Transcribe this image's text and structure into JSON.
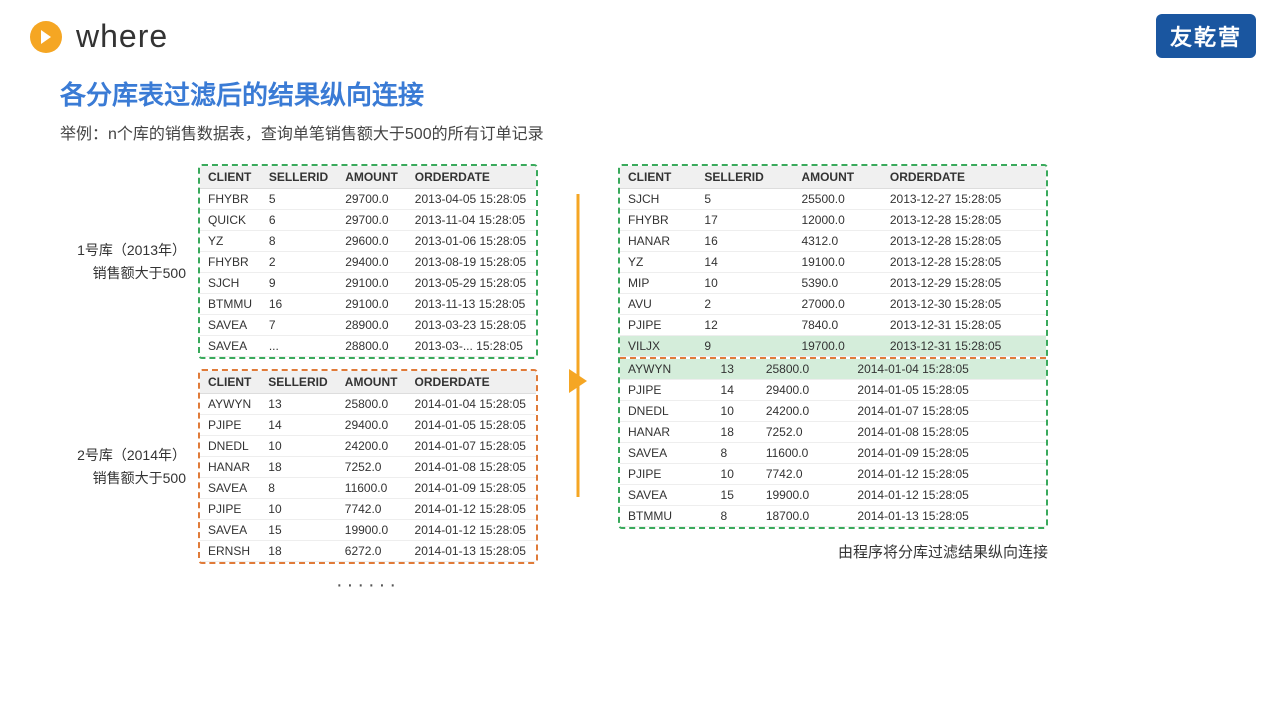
{
  "header": {
    "title": "where",
    "icon": "chevron-right",
    "logo": "友乾营"
  },
  "section": {
    "title": "各分库表过滤后的结果纵向连接",
    "subtitle": "举例：n个库的销售数据表，查询单笔销售额大于500的所有订单记录"
  },
  "db1": {
    "label_line1": "1号库（2013年）",
    "label_line2": "销售额大于500",
    "columns": [
      "CLIENT",
      "SELLERID",
      "AMOUNT",
      "ORDERDATE"
    ],
    "rows": [
      [
        "FHYBR",
        "5",
        "29700.0",
        "2013-04-05 15:28:05"
      ],
      [
        "QUICK",
        "6",
        "29700.0",
        "2013-11-04 15:28:05"
      ],
      [
        "YZ",
        "8",
        "29600.0",
        "2013-01-06 15:28:05"
      ],
      [
        "FHYBR",
        "2",
        "29400.0",
        "2013-08-19 15:28:05"
      ],
      [
        "SJCH",
        "9",
        "29100.0",
        "2013-05-29 15:28:05"
      ],
      [
        "BTMMU",
        "16",
        "29100.0",
        "2013-11-13 15:28:05"
      ],
      [
        "SAVEA",
        "7",
        "28900.0",
        "2013-03-23 15:28:05"
      ],
      [
        "SAVEA",
        "...",
        "28800.0",
        "2013-03-... 15:28:05"
      ]
    ]
  },
  "db2": {
    "label_line1": "2号库（2014年）",
    "label_line2": "销售额大于500",
    "columns": [
      "CLIENT",
      "SELLERID",
      "AMOUNT",
      "ORDERDATE"
    ],
    "rows": [
      [
        "AYWYN",
        "13",
        "25800.0",
        "2014-01-04 15:28:05"
      ],
      [
        "PJIPE",
        "14",
        "29400.0",
        "2014-01-05 15:28:05"
      ],
      [
        "DNEDL",
        "10",
        "24200.0",
        "2014-01-07 15:28:05"
      ],
      [
        "HANAR",
        "18",
        "7252.0",
        "2014-01-08 15:28:05"
      ],
      [
        "SAVEA",
        "8",
        "11600.0",
        "2014-01-09 15:28:05"
      ],
      [
        "PJIPE",
        "10",
        "7742.0",
        "2014-01-12 15:28:05"
      ],
      [
        "SAVEA",
        "15",
        "19900.0",
        "2014-01-12 15:28:05"
      ],
      [
        "ERNSH",
        "18",
        "6272.0",
        "2014-01-13 15:28:05"
      ]
    ]
  },
  "dots": "······",
  "right_table": {
    "columns": [
      "CLIENT",
      "SELLERID",
      "AMOUNT",
      "ORDERDATE"
    ],
    "rows_green": [
      [
        "SJCH",
        "5",
        "25500.0",
        "2013-12-27 15:28:05"
      ],
      [
        "FHYBR",
        "17",
        "12000.0",
        "2013-12-28 15:28:05"
      ],
      [
        "HANAR",
        "16",
        "4312.0",
        "2013-12-28 15:28:05"
      ],
      [
        "YZ",
        "14",
        "19100.0",
        "2013-12-28 15:28:05"
      ],
      [
        "MIP",
        "10",
        "5390.0",
        "2013-12-29 15:28:05"
      ],
      [
        "AVU",
        "2",
        "27000.0",
        "2013-12-30 15:28:05"
      ],
      [
        "PJIPE",
        "12",
        "7840.0",
        "2013-12-31 15:28:05"
      ],
      [
        "VILJX",
        "9",
        "19700.0",
        "2013-12-31 15:28:05"
      ]
    ],
    "rows_orange": [
      [
        "AYWYN",
        "13",
        "25800.0",
        "2014-01-04 15:28:05"
      ],
      [
        "PJIPE",
        "14",
        "29400.0",
        "2014-01-05 15:28:05"
      ],
      [
        "DNEDL",
        "10",
        "24200.0",
        "2014-01-07 15:28:05"
      ],
      [
        "HANAR",
        "18",
        "7252.0",
        "2014-01-08 15:28:05"
      ],
      [
        "SAVEA",
        "8",
        "11600.0",
        "2014-01-09 15:28:05"
      ],
      [
        "PJIPE",
        "10",
        "7742.0",
        "2014-01-12 15:28:05"
      ],
      [
        "SAVEA",
        "15",
        "19900.0",
        "2014-01-12 15:28:05"
      ],
      [
        "BTMMU",
        "8",
        "18700.0",
        "2014-01-13 15:28:05"
      ]
    ]
  },
  "bottom_note": "由程序将分库过滤结果纵向连接"
}
